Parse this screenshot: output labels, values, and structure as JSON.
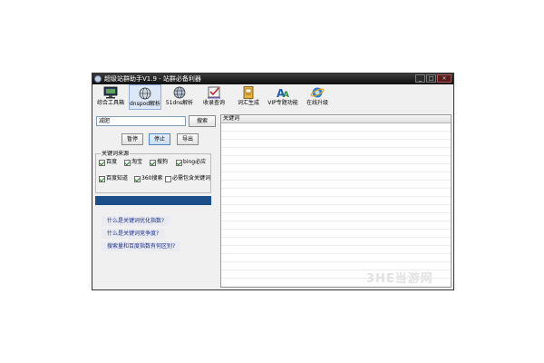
{
  "window": {
    "title": "超级站群助手V1.9 - 站群必备利器",
    "buttons": {
      "minimize": "_",
      "maximize": "□",
      "close": "×"
    }
  },
  "toolbar": {
    "items": [
      {
        "label": "综合工具箱",
        "icon": "monitor-icon"
      },
      {
        "label": "dnspod解析",
        "icon": "globe-icon",
        "active": true
      },
      {
        "label": "51dns解析",
        "icon": "globe-icon"
      },
      {
        "label": "收录查询",
        "icon": "checkbox-icon"
      },
      {
        "label": "词汇生成",
        "icon": "dictionary-icon"
      },
      {
        "label": "VIP专题功能",
        "icon": "fonts-icon"
      },
      {
        "label": "在线升级",
        "icon": "ie-icon"
      }
    ]
  },
  "search": {
    "input_value": "减肥",
    "button_label": "搜索"
  },
  "actions": {
    "pause": "暂停",
    "stop": "停止",
    "export": "导出"
  },
  "keyword_source": {
    "title": "关键词来源",
    "options": [
      {
        "label": "百度",
        "checked": true
      },
      {
        "label": "淘宝",
        "checked": true
      },
      {
        "label": "搜狗",
        "checked": true
      },
      {
        "label": "bing必应",
        "checked": true
      },
      {
        "label": "百度知道",
        "checked": true
      },
      {
        "label": "360搜索",
        "checked": true
      },
      {
        "label": "必需包含关键词",
        "checked": false
      }
    ]
  },
  "progress": {
    "value": 1.0,
    "color": "#1c4e8a"
  },
  "links": [
    "什么是关键词优化指数?",
    "什么是关键词竞争度?",
    "搜索量和百度指数有何区别?"
  ],
  "results": {
    "column_header": "关键词"
  },
  "watermark": "3HE当游网"
}
